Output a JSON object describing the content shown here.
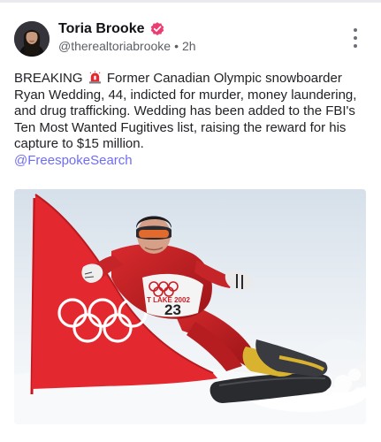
{
  "post": {
    "author": {
      "display_name": "Toria Brooke",
      "handle": "@therealtoriabrooke",
      "verified": true
    },
    "separator": "•",
    "timestamp": "2h",
    "text": {
      "lead": "BREAKING",
      "body": "Former Canadian Olympic snowboarder Ryan Wedding, 44, indicted for murder, money laundering, and drug trafficking. Wedding has been added to the FBI's Ten Most Wanted Fugitives list, raising the reward for his capture to $15 million.",
      "mention": "@FreespokeSearch"
    },
    "media": {
      "bib_text": "T LAKE 2002",
      "bib_number": "23"
    }
  },
  "icons": {
    "verified": "verified-badge-icon",
    "more": "more-options-icon",
    "siren": "rotating-light-icon"
  },
  "colors": {
    "verified_badge": "#ec3d73",
    "mention": "#6f6df2",
    "flag_red": "#e3282f"
  }
}
